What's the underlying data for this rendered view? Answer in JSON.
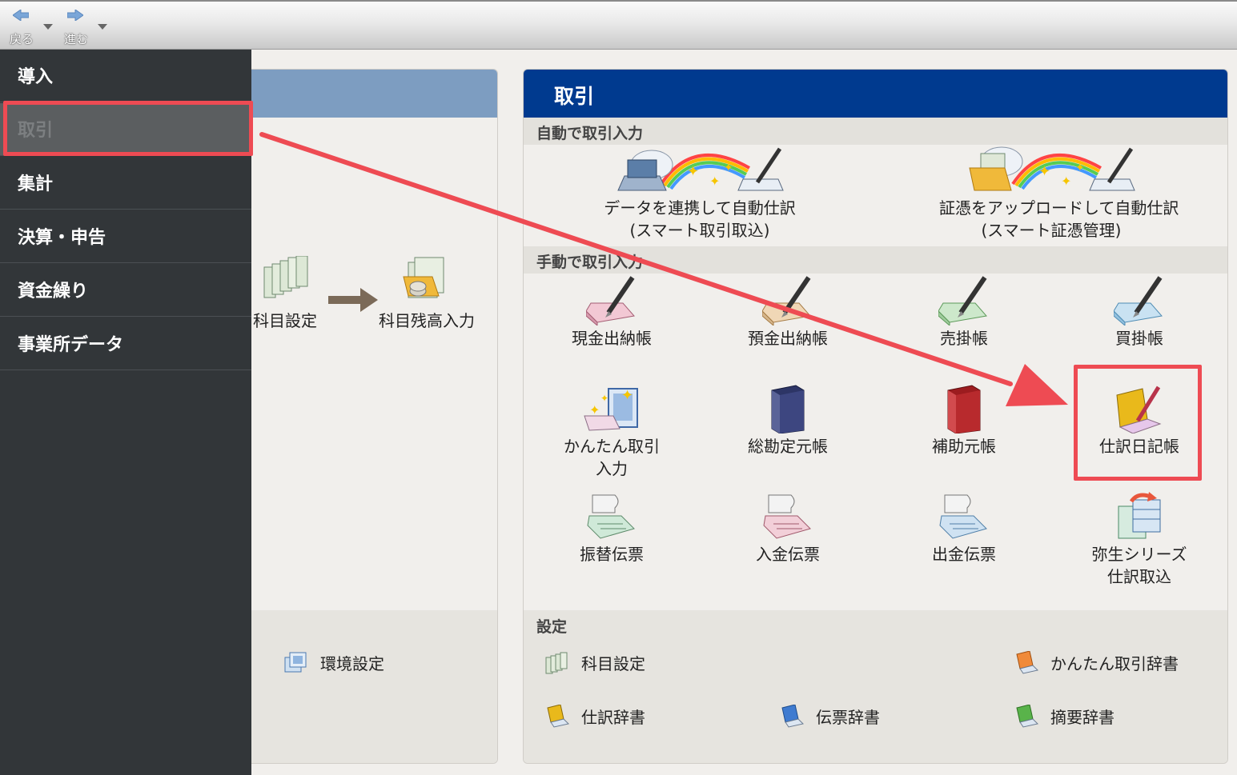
{
  "toolbar": {
    "back_label": "戻る",
    "forward_label": "進む"
  },
  "sidebar": {
    "items": [
      {
        "label": "導入"
      },
      {
        "label": "取引"
      },
      {
        "label": "集計"
      },
      {
        "label": "決算・申告"
      },
      {
        "label": "資金繰り"
      },
      {
        "label": "事業所データ"
      }
    ],
    "active_item": "取引"
  },
  "left_panel": {
    "flow_items": [
      {
        "label": "科目設定"
      },
      {
        "label": "科目残高入力"
      }
    ],
    "settings_link": "環境設定"
  },
  "main_panel": {
    "title": "取引",
    "auto_section": {
      "title": "自動で取引入力",
      "items": [
        {
          "line1": "データを連携して自動仕訳",
          "line2": "(スマート取引取込)"
        },
        {
          "line1": "証憑をアップロードして自動仕訳",
          "line2": "(スマート証憑管理)"
        }
      ]
    },
    "manual_section": {
      "title": "手動で取引入力",
      "items": [
        {
          "line1": "現金出納帳",
          "line2": ""
        },
        {
          "line1": "預金出納帳",
          "line2": ""
        },
        {
          "line1": "売掛帳",
          "line2": ""
        },
        {
          "line1": "買掛帳",
          "line2": ""
        },
        {
          "line1": "かんたん取引",
          "line2": "入力"
        },
        {
          "line1": "総勘定元帳",
          "line2": ""
        },
        {
          "line1": "補助元帳",
          "line2": ""
        },
        {
          "line1": "仕訳日記帳",
          "line2": ""
        },
        {
          "line1": "振替伝票",
          "line2": ""
        },
        {
          "line1": "入金伝票",
          "line2": ""
        },
        {
          "line1": "出金伝票",
          "line2": ""
        },
        {
          "line1": "弥生シリーズ",
          "line2": "仕訳取込"
        }
      ]
    },
    "settings_section": {
      "title": "設定",
      "links": [
        {
          "label": "科目設定"
        },
        {
          "label": "かんたん取引辞書"
        },
        {
          "label": "仕訳辞書"
        },
        {
          "label": "伝票辞書"
        },
        {
          "label": "摘要辞書"
        }
      ]
    }
  },
  "colors": {
    "sidebar_bg": "#323639",
    "main_header": "#003a8f",
    "left_header": "#7d9dc1",
    "highlight": "#ee4b53",
    "content_bg": "#f1efec"
  }
}
